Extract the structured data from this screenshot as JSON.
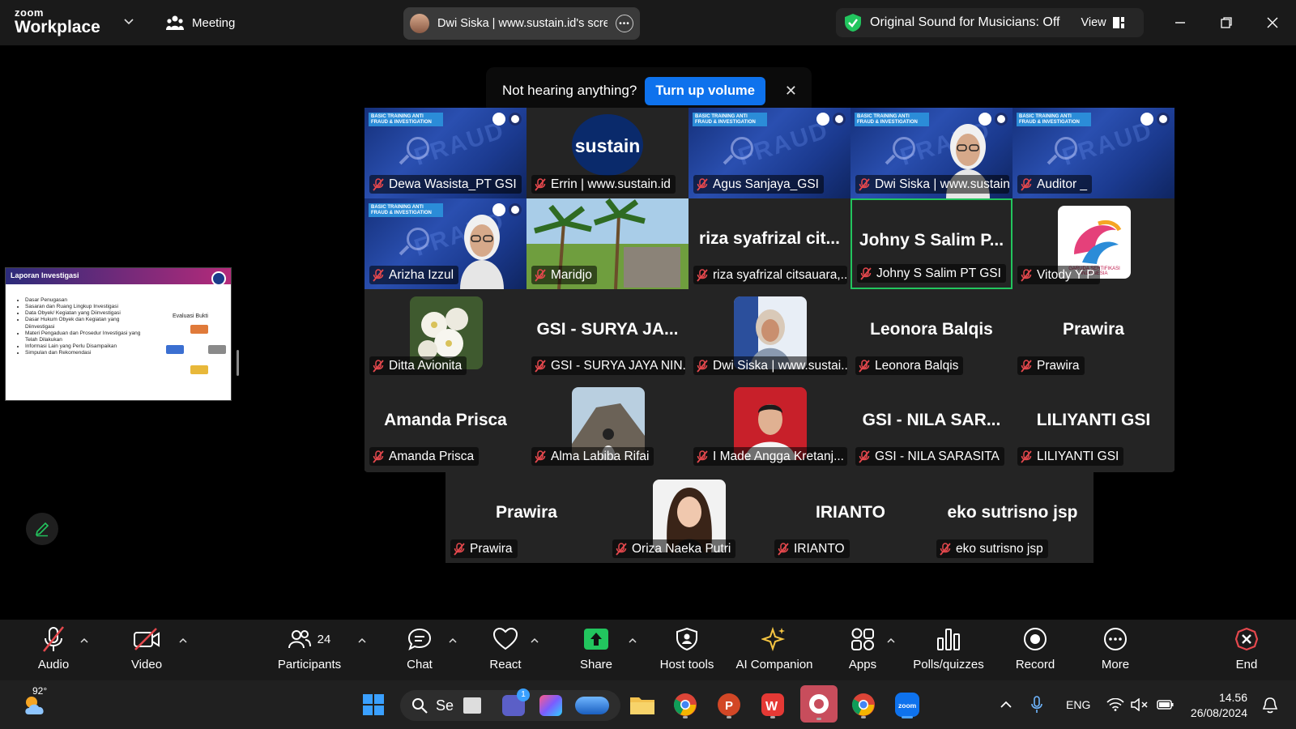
{
  "titlebar": {
    "logo_small": "zoom",
    "logo_big": "Workplace",
    "meeting_label": "Meeting",
    "share_title": "Dwi Siska | www.sustain.id's scree",
    "sound_label": "Original Sound for Musicians: Off",
    "view_label": "View"
  },
  "notification": {
    "text": "Not hearing anything?",
    "button": "Turn up volume"
  },
  "participants": [
    {
      "name": "Dewa Wasista_PT GSI",
      "type": "banner"
    },
    {
      "name": "Errin | www.sustain.id",
      "type": "logo",
      "logo_text": "sustain"
    },
    {
      "name": "Agus Sanjaya_GSI",
      "type": "banner"
    },
    {
      "name": "Dwi Siska | www.sustain.id",
      "type": "banner-face"
    },
    {
      "name": "Auditor _",
      "type": "banner"
    },
    {
      "name": "Arizha Izzul",
      "type": "banner-face"
    },
    {
      "name": "Maridjo",
      "type": "beach"
    },
    {
      "name": "riza syafrizal citsauara,...",
      "type": "text",
      "big": "riza syafrizal cit..."
    },
    {
      "name": "Johny S Salim PT GSI",
      "type": "text",
      "big": "Johny S Salim P...",
      "active": true
    },
    {
      "name": "Vitody Y P",
      "type": "garuda",
      "logo_text": "GARUDA SERTIFIKASI INDONESIA"
    },
    {
      "name": "Ditta Avionita",
      "type": "flower"
    },
    {
      "name": "GSI - SURYA JAYA NIN...",
      "type": "text",
      "big": "GSI - SURYA JA..."
    },
    {
      "name": "Dwi Siska | www.sustai...",
      "type": "photo-woman"
    },
    {
      "name": "Leonora Balqis",
      "type": "text",
      "big": "Leonora Balqis"
    },
    {
      "name": "Prawira",
      "type": "text",
      "big": "Prawira"
    },
    {
      "name": "Amanda Prisca",
      "type": "text",
      "big": "Amanda Prisca"
    },
    {
      "name": "Alma Labiba Rifai",
      "type": "mountain"
    },
    {
      "name": "I Made Angga Kretanj...",
      "type": "photo-man"
    },
    {
      "name": "GSI - NILA SARASITA",
      "type": "text",
      "big": "GSI - NILA SAR..."
    },
    {
      "name": "LILIYANTI GSI",
      "type": "text",
      "big": "LILIYANTI GSI"
    }
  ],
  "last_row": [
    {
      "name": "Prawira",
      "type": "text",
      "big": "Prawira"
    },
    {
      "name": "Oriza Naeka Putri",
      "type": "photo-girl"
    },
    {
      "name": "IRIANTO",
      "type": "text",
      "big": "IRIANTO"
    },
    {
      "name": "eko sutrisno jsp",
      "type": "text",
      "big": "eko sutrisno jsp"
    }
  ],
  "banner_tag": "BASIC TRAINING ANTI FRAUD & INVESTIGATION",
  "banner_watermark": "FRAUD",
  "slide": {
    "title": "Laporan Investigasi",
    "items": [
      "Dasar Penugasan",
      "Sasaran dan Ruang Lingkup Investigasi",
      "Data Obyek/ Kegiatan yang Diinvestigasi",
      "Dasar Hukum Obyek dan Kegiatan yang Diinvestigasi",
      "Materi Pengaduan dan Prosedur Investigasi yang Telah Dilakukan",
      "Informasi Lain yang Perlu Disampaikan",
      "Simpulan dan Rekomendasi"
    ],
    "eval_label": "Evaluasi Bukti"
  },
  "toolbar": {
    "audio": "Audio",
    "video": "Video",
    "participants": "Participants",
    "participants_count": "24",
    "chat": "Chat",
    "react": "React",
    "share": "Share",
    "host_tools": "Host tools",
    "ai_companion": "AI Companion",
    "apps": "Apps",
    "polls": "Polls/quizzes",
    "record": "Record",
    "more": "More",
    "end": "End"
  },
  "taskbar": {
    "weather_temp": "92°",
    "search_text": "Se",
    "lang": "ENG",
    "time": "14.56",
    "date": "26/08/2024",
    "teams_badge": "1"
  },
  "colors": {
    "accent": "#0e72ed",
    "active_speaker": "#22c55e",
    "end_red": "#e5484d"
  }
}
